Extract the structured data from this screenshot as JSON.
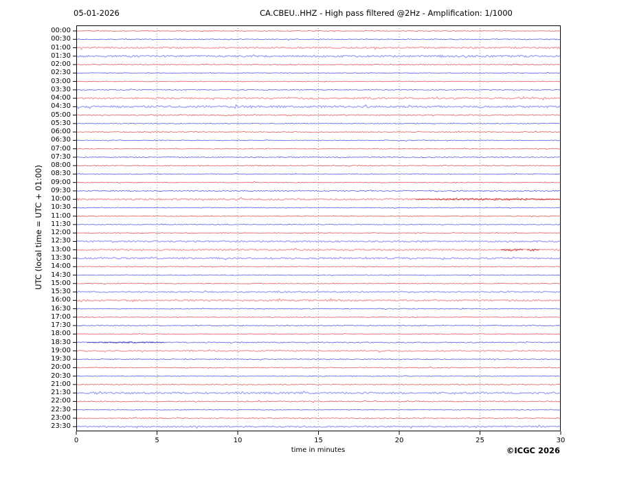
{
  "header": {
    "date": "05-01-2026",
    "title": "CA.CBEU..HHZ - High pass filtered @2Hz - Amplification: 1/1000"
  },
  "footer": {
    "credit": "©ICGC 2026"
  },
  "colors": {
    "trace_red": "#e05a5a",
    "trace_red_light": "#f2a4a4",
    "trace_blue": "#5a5ae0",
    "trace_blue_light": "#a6a6f2",
    "event_red": "#c22727",
    "event_blue": "#3c3cc2",
    "grid": "#808080",
    "frame": "#000000"
  },
  "chart_data": {
    "type": "line",
    "subtype": "helicorder-seismogram",
    "title": "CA.CBEU..HHZ - High pass filtered @2Hz - Amplification: 1/1000",
    "date": "05-01-2026",
    "station": "CA.CBEU..HHZ",
    "filter": "High pass filtered @2Hz",
    "amplification": "1/1000",
    "xlabel": "time in minutes",
    "ylabel": "UTC (local time = UTC + 01:00)",
    "x_range": [
      0,
      30
    ],
    "x_ticks": [
      0,
      5,
      10,
      15,
      20,
      25,
      30
    ],
    "x_gridlines": [
      5,
      10,
      15,
      20,
      25
    ],
    "minutes_per_row": 30,
    "rows": [
      {
        "label": "00:00",
        "color": "red",
        "amp": 0.5
      },
      {
        "label": "00:30",
        "color": "blue",
        "amp": 0.6
      },
      {
        "label": "01:00",
        "color": "red",
        "amp": 1.1
      },
      {
        "label": "01:30",
        "color": "blue",
        "amp": 1.3
      },
      {
        "label": "02:00",
        "color": "red",
        "amp": 0.6
      },
      {
        "label": "02:30",
        "color": "blue",
        "amp": 0.5
      },
      {
        "label": "03:00",
        "color": "red",
        "amp": 0.5
      },
      {
        "label": "03:30",
        "color": "blue",
        "amp": 0.6
      },
      {
        "label": "04:00",
        "color": "red",
        "amp": 1.1
      },
      {
        "label": "04:30",
        "color": "blue",
        "amp": 1.3
      },
      {
        "label": "05:00",
        "color": "red",
        "amp": 0.7
      },
      {
        "label": "05:30",
        "color": "blue",
        "amp": 0.5
      },
      {
        "label": "06:00",
        "color": "red",
        "amp": 0.6
      },
      {
        "label": "06:30",
        "color": "blue",
        "amp": 0.5
      },
      {
        "label": "07:00",
        "color": "red",
        "amp": 0.5
      },
      {
        "label": "07:30",
        "color": "blue",
        "amp": 0.7
      },
      {
        "label": "08:00",
        "color": "red",
        "amp": 0.6
      },
      {
        "label": "08:30",
        "color": "blue",
        "amp": 0.5
      },
      {
        "label": "09:00",
        "color": "red",
        "amp": 0.5
      },
      {
        "label": "09:30",
        "color": "blue",
        "amp": 0.8
      },
      {
        "label": "10:00",
        "color": "red",
        "amp": 1.2
      },
      {
        "label": "10:30",
        "color": "blue",
        "amp": 0.5
      },
      {
        "label": "11:00",
        "color": "red",
        "amp": 0.5
      },
      {
        "label": "11:30",
        "color": "blue",
        "amp": 0.5
      },
      {
        "label": "12:00",
        "color": "red",
        "amp": 0.5
      },
      {
        "label": "12:30",
        "color": "blue",
        "amp": 1.0
      },
      {
        "label": "13:00",
        "color": "red",
        "amp": 1.1
      },
      {
        "label": "13:30",
        "color": "blue",
        "amp": 1.0
      },
      {
        "label": "14:00",
        "color": "red",
        "amp": 0.5
      },
      {
        "label": "14:30",
        "color": "blue",
        "amp": 0.5
      },
      {
        "label": "15:00",
        "color": "red",
        "amp": 0.5
      },
      {
        "label": "15:30",
        "color": "blue",
        "amp": 0.9
      },
      {
        "label": "16:00",
        "color": "red",
        "amp": 1.1
      },
      {
        "label": "16:30",
        "color": "blue",
        "amp": 0.6
      },
      {
        "label": "17:00",
        "color": "red",
        "amp": 0.5
      },
      {
        "label": "17:30",
        "color": "blue",
        "amp": 0.6
      },
      {
        "label": "18:00",
        "color": "red",
        "amp": 0.5
      },
      {
        "label": "18:30",
        "color": "blue",
        "amp": 0.7
      },
      {
        "label": "19:00",
        "color": "red",
        "amp": 0.9
      },
      {
        "label": "19:30",
        "color": "blue",
        "amp": 0.6
      },
      {
        "label": "20:00",
        "color": "red",
        "amp": 0.6
      },
      {
        "label": "20:30",
        "color": "blue",
        "amp": 0.5
      },
      {
        "label": "21:00",
        "color": "red",
        "amp": 0.5
      },
      {
        "label": "21:30",
        "color": "blue",
        "amp": 1.2
      },
      {
        "label": "22:00",
        "color": "red",
        "amp": 0.8
      },
      {
        "label": "22:30",
        "color": "blue",
        "amp": 0.5
      },
      {
        "label": "23:00",
        "color": "red",
        "amp": 0.6
      },
      {
        "label": "23:30",
        "color": "blue",
        "amp": 1.0
      }
    ],
    "events": [
      {
        "row": "10:00",
        "row_index": 20,
        "start_min": 21.0,
        "end_min": 30.0,
        "amp": 1.6
      },
      {
        "row": "13:00",
        "row_index": 26,
        "start_min": 26.3,
        "end_min": 27.7,
        "amp": 2.2
      },
      {
        "row": "13:00",
        "row_index": 26,
        "start_min": 27.9,
        "end_min": 28.7,
        "amp": 1.8
      },
      {
        "row": "18:30",
        "row_index": 37,
        "start_min": 0.7,
        "end_min": 5.5,
        "amp": 1.4
      }
    ]
  }
}
